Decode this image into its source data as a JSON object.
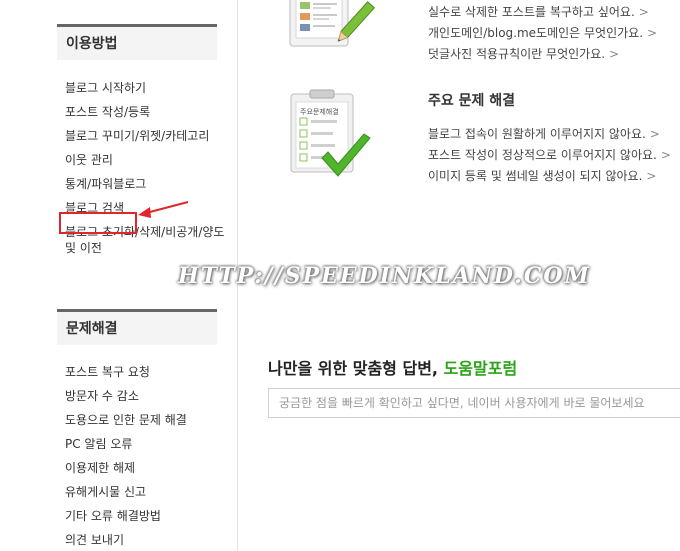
{
  "sidebar": {
    "section1_title": "이용방법",
    "section1_items": [
      "블로그 시작하기",
      "포스트 작성/등록",
      "블로그 꾸미기/위젯/카테고리",
      "이웃 관리",
      "통계/파워블로그",
      "블로그 검색",
      "블로그 초기화/삭제/비공개/양도 및 이전"
    ],
    "section2_title": "문제해결",
    "section2_items": [
      "포스트 복구 요청",
      "방문자 수 감소",
      "도용으로 인한 문제 해결",
      "PC 알림 오류",
      "이용제한 해제",
      "유해게시물 신고",
      "기타 오류 해결방법",
      "의견 보내기"
    ]
  },
  "faq_top": {
    "links": [
      "실수로 삭제한 포스트를 복구하고 싶어요.",
      "개인도메인/blog.me도메인은 무엇인가요.",
      "덧글사진 적용규칙이란 무엇인가요."
    ]
  },
  "faq_main": {
    "title": "주요 문제 해결",
    "clipboard_label": "주요문제해결",
    "links": [
      "블로그 접속이 원활하게 이루어지지 않아요.",
      "포스트 작성이 정상적으로 이루어지지 않아요.",
      "이미지 등록 및 썸네일 생성이 되지 않아요."
    ]
  },
  "chevron": ">",
  "watermark": "HTTP://SPEEDINKLAND.COM",
  "forum": {
    "title_prefix": "나만을 위한 맞춤형 답변, ",
    "title_highlight": "도움말포럼",
    "placeholder": "궁금한 점을 빠르게 확인하고 싶다면, 네이버 사용자에게 바로 물어보세요"
  },
  "colors": {
    "highlight_red": "#e0262b",
    "forum_green": "#2aa316",
    "check_green": "#4fb52a"
  }
}
